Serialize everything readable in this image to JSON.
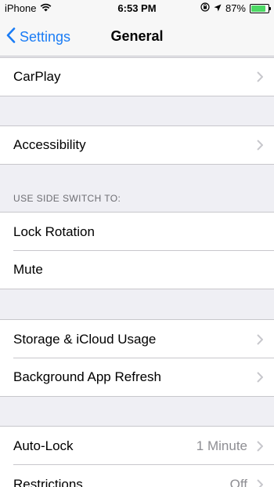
{
  "status_bar": {
    "carrier": "iPhone",
    "time": "6:53 PM",
    "battery": "87%",
    "battery_level": 0.87,
    "battery_color": "#4cd964"
  },
  "nav": {
    "back_label": "Settings",
    "title": "General"
  },
  "rows": {
    "carplay": "CarPlay",
    "accessibility": "Accessibility",
    "side_switch_header": "USE SIDE SWITCH TO:",
    "lock_rotation": "Lock Rotation",
    "mute": "Mute",
    "storage": "Storage & iCloud Usage",
    "background_refresh": "Background App Refresh",
    "auto_lock": "Auto-Lock",
    "auto_lock_value": "1 Minute",
    "restrictions": "Restrictions",
    "restrictions_value": "Off"
  },
  "colors": {
    "accent": "#1a7cf5",
    "background": "#efeff4",
    "secondary_text": "#8e8e93"
  },
  "icons": [
    "wifi-icon",
    "orientation-lock-icon",
    "location-arrow-icon",
    "battery-icon",
    "back-chevron-icon",
    "chevron-right-icon"
  ]
}
